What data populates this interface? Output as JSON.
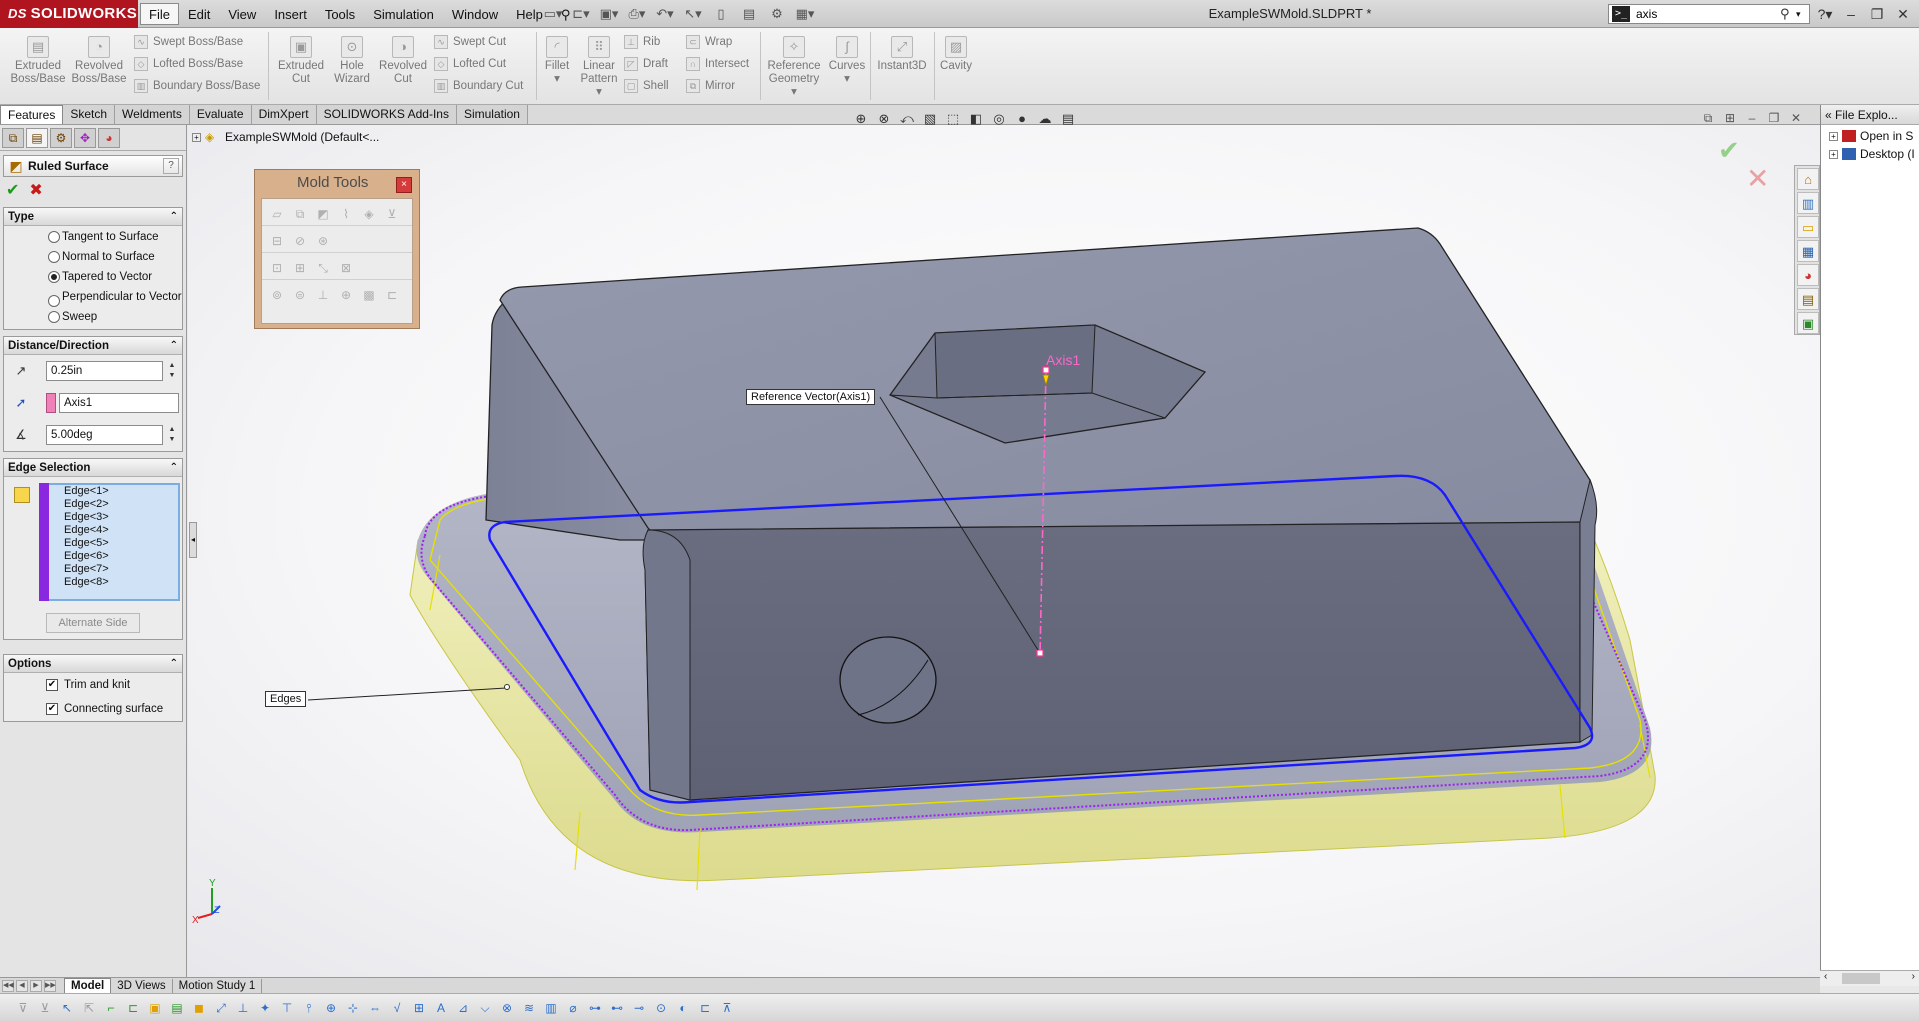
{
  "app": {
    "logo_text": "SOLIDWORKS",
    "logo_mark": "DS",
    "document_title": "ExampleSWMold.SLDPRT *"
  },
  "menu": [
    "File",
    "Edit",
    "View",
    "Insert",
    "Tools",
    "Simulation",
    "Window",
    "Help"
  ],
  "search": {
    "value": "axis",
    "placeholder": ""
  },
  "ribbon": {
    "extruded_boss": "Extruded\nBoss/Base",
    "revolved_boss": "Revolved\nBoss/Base",
    "swept_boss": "Swept Boss/Base",
    "lofted_boss": "Lofted Boss/Base",
    "boundary_boss": "Boundary Boss/Base",
    "extruded_cut": "Extruded\nCut",
    "hole_wizard": "Hole\nWizard",
    "revolved_cut": "Revolved\nCut",
    "swept_cut": "Swept Cut",
    "lofted_cut": "Lofted Cut",
    "boundary_cut": "Boundary Cut",
    "fillet": "Fillet",
    "linear_pattern": "Linear\nPattern",
    "rib": "Rib",
    "draft": "Draft",
    "shell": "Shell",
    "wrap": "Wrap",
    "intersect": "Intersect",
    "mirror": "Mirror",
    "reference_geometry": "Reference\nGeometry",
    "curves": "Curves",
    "instant3d": "Instant3D",
    "cavity": "Cavity"
  },
  "command_tabs": [
    "Features",
    "Sketch",
    "Weldments",
    "Evaluate",
    "DimXpert",
    "SOLIDWORKS Add-Ins",
    "Simulation"
  ],
  "property_manager": {
    "title": "Ruled Surface",
    "help": "?",
    "ok": "✔",
    "cancel": "✖",
    "type_group": {
      "title": "Type",
      "options": [
        "Tangent to Surface",
        "Normal to Surface",
        "Tapered to Vector",
        "Perpendicular to Vector",
        "Sweep"
      ],
      "selected_index": 2
    },
    "distance_group": {
      "title": "Distance/Direction",
      "distance": "0.25in",
      "direction": "Axis1",
      "angle": "5.00deg"
    },
    "edge_group": {
      "title": "Edge Selection",
      "edges": [
        "Edge<1>",
        "Edge<2>",
        "Edge<3>",
        "Edge<4>",
        "Edge<5>",
        "Edge<6>",
        "Edge<7>",
        "Edge<8>"
      ],
      "alternate_side": "Alternate Side"
    },
    "options_group": {
      "title": "Options",
      "trim_and_knit": "Trim and knit",
      "connecting_surface": "Connecting surface"
    }
  },
  "tree": {
    "root": "ExampleSWMold  (Default<..."
  },
  "mold_tools": {
    "title": "Mold Tools",
    "close": "×"
  },
  "callouts": {
    "reference_vector": "Reference Vector(Axis1)",
    "edges": "Edges",
    "axis": "Axis1"
  },
  "triad": {
    "x": "X",
    "y": "Y",
    "z": "Z"
  },
  "file_explorer": {
    "title": "File Explo...",
    "items": [
      "Open in S",
      "Desktop (I"
    ]
  },
  "bottom_tabs": [
    "Model",
    "3D Views",
    "Motion Study 1"
  ],
  "colors": {
    "part_face": "#8f93a8",
    "selection_blue": "#1a1aff",
    "selection_purple": "#a020f0",
    "ruled_surface": "#e8e6a0",
    "axis_pink": "#ff66cc",
    "ribbon_bg": "#eeeeee"
  }
}
